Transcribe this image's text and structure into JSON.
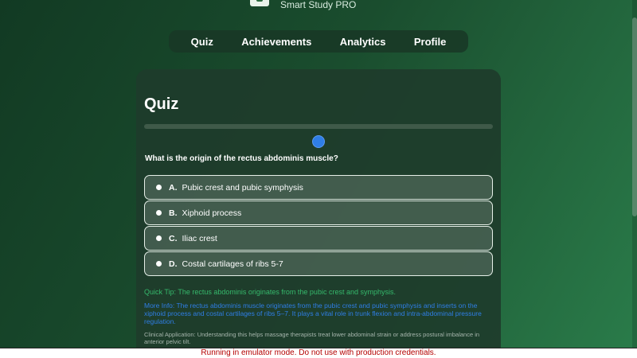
{
  "app": {
    "name": "Smart Study PRO"
  },
  "nav": {
    "items": [
      {
        "label": "Quiz"
      },
      {
        "label": "Achievements"
      },
      {
        "label": "Analytics"
      },
      {
        "label": "Profile"
      }
    ]
  },
  "quiz": {
    "title": "Quiz",
    "progress": 0.0,
    "question": "What is the origin of the rectus abdominis muscle?",
    "options": [
      {
        "letter": "A.",
        "text": "Pubic crest and pubic symphysis"
      },
      {
        "letter": "B.",
        "text": "Xiphoid process"
      },
      {
        "letter": "C.",
        "text": "Iliac crest"
      },
      {
        "letter": "D.",
        "text": "Costal cartilages of ribs 5-7"
      }
    ],
    "tip": "Quick Tip: The rectus abdominis originates from the pubic crest and symphysis.",
    "more_info": "More Info: The rectus abdominis muscle originates from the pubic crest and pubic symphysis and inserts on the xiphoid process and costal cartilages of ribs 5–7. It plays a vital role in trunk flexion and intra-abdominal pressure regulation.",
    "clinical": "Clinical Application: Understanding this helps massage therapists treat lower abdominal strain or address postural imbalance in anterior pelvic tilt."
  },
  "banner": {
    "text": "Running in emulator mode. Do not use with production credentials."
  },
  "colors": {
    "tip": "#35b86b",
    "info": "#2f7ee6",
    "accent": "#2f7ee6",
    "warning": "#b30000"
  }
}
